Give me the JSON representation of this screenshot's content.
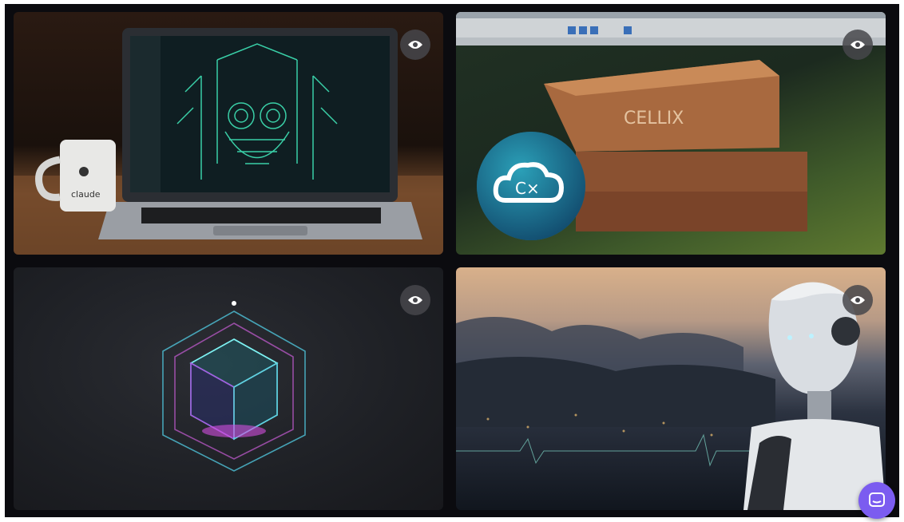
{
  "gallery": {
    "tiles": [
      {
        "subject": "Laptop with circuit skull artwork and coffee mug",
        "mug_text": "claude",
        "eye_icon": "eye-icon"
      },
      {
        "subject": "Stacked boxes with C× cloud logo",
        "box_text": "CELLIX",
        "logo_text": "C×",
        "eye_icon": "eye-icon"
      },
      {
        "subject": "Neon wireframe cube",
        "eye_icon": "eye-icon"
      },
      {
        "subject": "Humanoid robot with mountain landscape",
        "eye_icon": "eye-icon"
      }
    ]
  },
  "colors": {
    "accent": "#7b5cf0",
    "eye_bg": "#46464b",
    "background": "#0b0b0f"
  },
  "chat_button": {
    "icon": "chat-icon"
  }
}
